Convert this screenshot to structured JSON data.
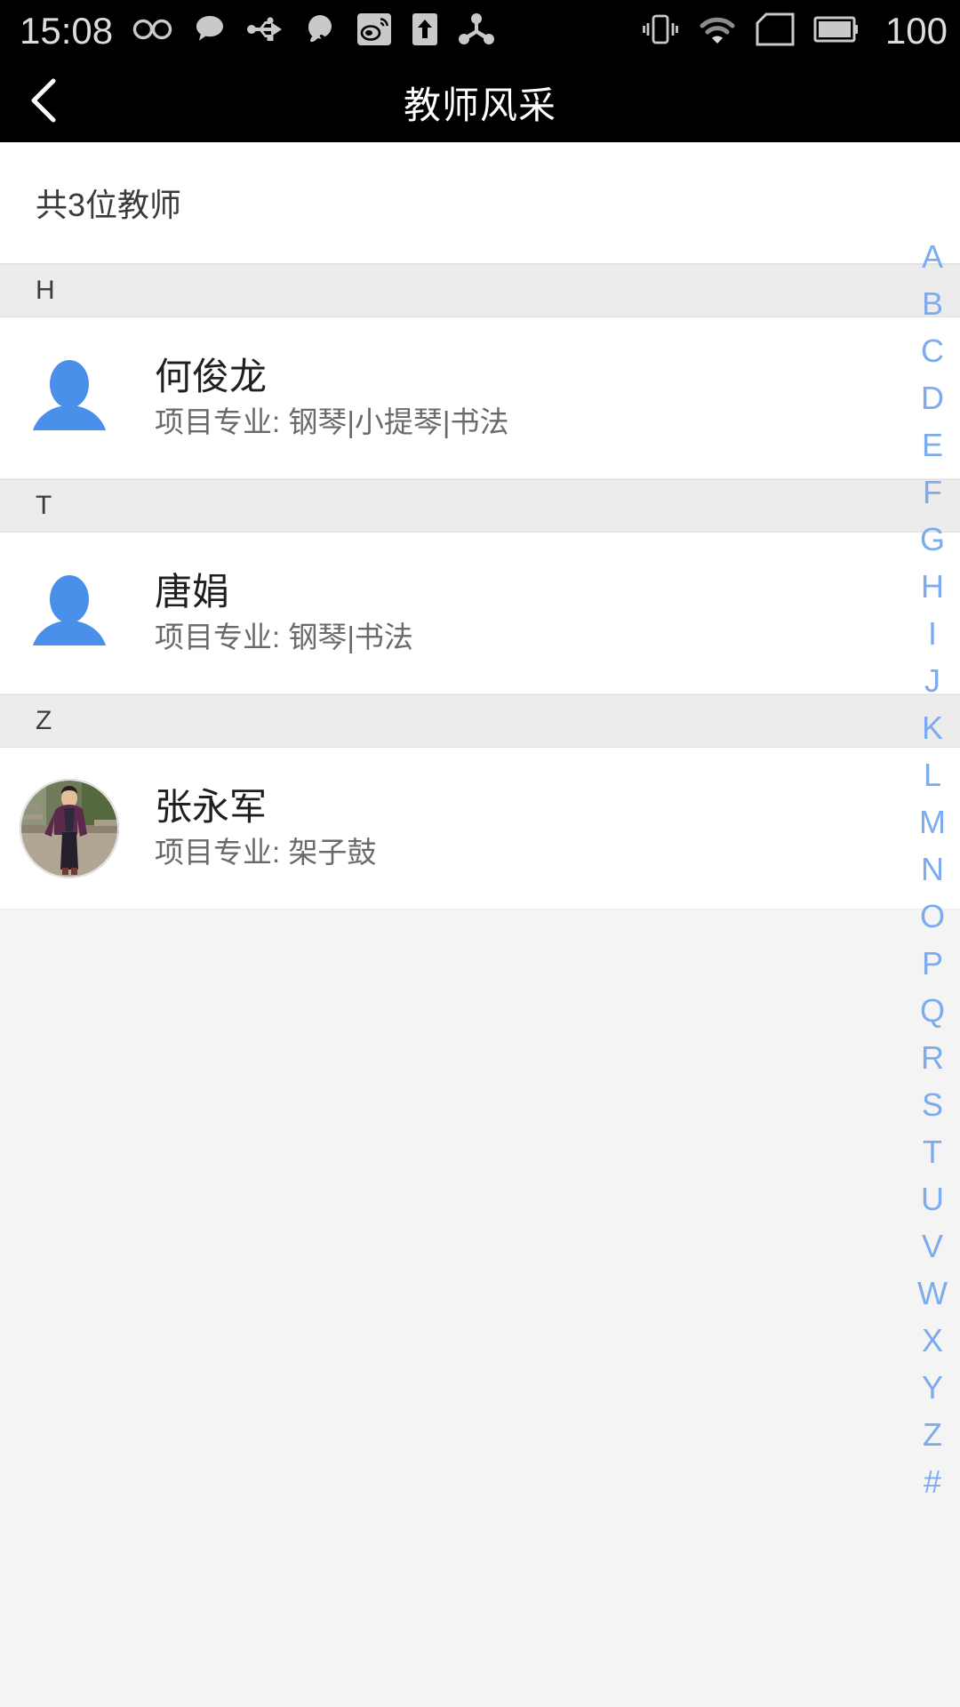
{
  "statusbar": {
    "time": "15:08",
    "battery_level": "100",
    "left_icons": [
      "infinity-icon",
      "message-bubble-icon",
      "usb-icon",
      "qq-icon",
      "weibo-icon",
      "upload-arrow-icon",
      "share-nodes-icon"
    ],
    "right_icons": [
      "vibrate-icon",
      "wifi-icon",
      "sim-card-icon",
      "battery-icon"
    ]
  },
  "header": {
    "title": "教师风采",
    "back_icon": "chevron-left-icon"
  },
  "summary": {
    "count_text": "共3位教师"
  },
  "sections": [
    {
      "letter": "H",
      "teachers": [
        {
          "name": "何俊龙",
          "major": "项目专业: 钢琴|小提琴|书法",
          "avatar_type": "placeholder"
        }
      ]
    },
    {
      "letter": "T",
      "teachers": [
        {
          "name": "唐娟",
          "major": "项目专业: 钢琴|书法",
          "avatar_type": "placeholder"
        }
      ]
    },
    {
      "letter": "Z",
      "teachers": [
        {
          "name": "张永军",
          "major": "项目专业: 架子鼓",
          "avatar_type": "photo"
        }
      ]
    }
  ],
  "index_bar": {
    "letters": [
      "A",
      "B",
      "C",
      "D",
      "E",
      "F",
      "G",
      "H",
      "I",
      "J",
      "K",
      "L",
      "M",
      "N",
      "O",
      "P",
      "Q",
      "R",
      "S",
      "T",
      "U",
      "V",
      "W",
      "X",
      "Y",
      "Z",
      "#"
    ]
  },
  "colors": {
    "accent_blue": "#4a90ea",
    "index_blue": "#7cabee",
    "section_bg": "#ececec",
    "page_bg": "#f4f4f4",
    "statusbar_bg": "#000000"
  }
}
